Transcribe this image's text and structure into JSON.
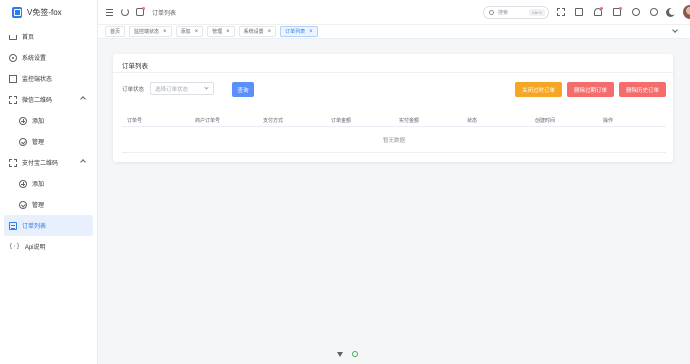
{
  "app": {
    "name": "V免签-fox"
  },
  "sidebar": {
    "items": [
      {
        "label": "首页",
        "icon": "home-icon"
      },
      {
        "label": "系统设置",
        "icon": "gear-icon"
      },
      {
        "label": "监控端状态",
        "icon": "monitor-icon"
      },
      {
        "label": "微信二维码",
        "icon": "qrcode-icon",
        "expanded": true
      },
      {
        "label": "添加",
        "icon": "add-circle-icon",
        "sub": true
      },
      {
        "label": "管理",
        "icon": "check-circle-icon",
        "sub": true
      },
      {
        "label": "支付宝二维码",
        "icon": "qrcode-icon",
        "expanded": true
      },
      {
        "label": "添加",
        "icon": "add-circle-icon",
        "sub": true
      },
      {
        "label": "管理",
        "icon": "check-circle-icon",
        "sub": true
      },
      {
        "label": "订单列表",
        "icon": "list-icon",
        "active": true
      },
      {
        "label": "Api说明",
        "icon": "api-icon"
      }
    ]
  },
  "header": {
    "breadcrumb": "订单列表",
    "search": {
      "placeholder": "搜索",
      "shortcut": "Ctrl K"
    }
  },
  "tabs": [
    {
      "label": "首页",
      "closable": false
    },
    {
      "label": "监控端状态",
      "closable": true
    },
    {
      "label": "添加",
      "closable": true
    },
    {
      "label": "管理",
      "closable": true
    },
    {
      "label": "系统设置",
      "closable": true
    },
    {
      "label": "订单列表",
      "closable": true,
      "active": true
    }
  ],
  "card": {
    "title": "订单列表",
    "filter": {
      "label": "订单状态",
      "placeholder": "选择订单状态"
    },
    "buttons": {
      "query": "查询",
      "close_expired": "关闭过时订单",
      "delete_expired": "删除过期订单",
      "delete_history": "删除历史订单"
    },
    "table": {
      "columns": [
        "订单号",
        "商户订单号",
        "支付方式",
        "订单金额",
        "实付金额",
        "状态",
        "创建时间",
        "操作"
      ],
      "empty_text": "暂无数据"
    }
  },
  "colors": {
    "primary": "#2b7de9",
    "warning": "#f5a623",
    "danger": "#f56c6c",
    "query_btn": "#5b8ff9"
  }
}
